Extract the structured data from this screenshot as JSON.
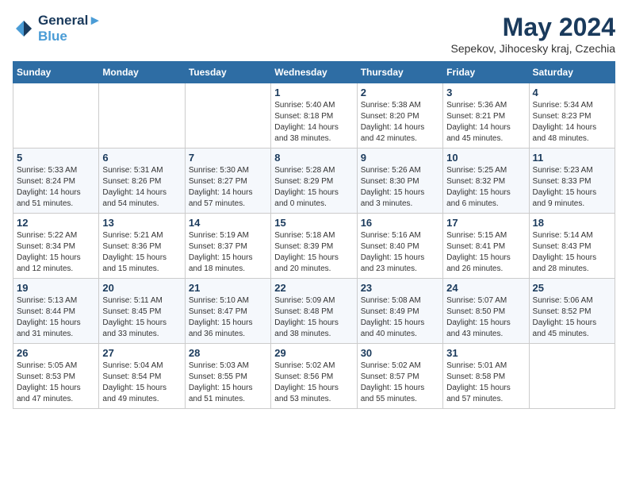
{
  "header": {
    "logo_line1": "General",
    "logo_line2": "Blue",
    "month": "May 2024",
    "location": "Sepekov, Jihocesky kraj, Czechia"
  },
  "weekdays": [
    "Sunday",
    "Monday",
    "Tuesday",
    "Wednesday",
    "Thursday",
    "Friday",
    "Saturday"
  ],
  "weeks": [
    [
      {
        "day": "",
        "info": ""
      },
      {
        "day": "",
        "info": ""
      },
      {
        "day": "",
        "info": ""
      },
      {
        "day": "1",
        "info": "Sunrise: 5:40 AM\nSunset: 8:18 PM\nDaylight: 14 hours\nand 38 minutes."
      },
      {
        "day": "2",
        "info": "Sunrise: 5:38 AM\nSunset: 8:20 PM\nDaylight: 14 hours\nand 42 minutes."
      },
      {
        "day": "3",
        "info": "Sunrise: 5:36 AM\nSunset: 8:21 PM\nDaylight: 14 hours\nand 45 minutes."
      },
      {
        "day": "4",
        "info": "Sunrise: 5:34 AM\nSunset: 8:23 PM\nDaylight: 14 hours\nand 48 minutes."
      }
    ],
    [
      {
        "day": "5",
        "info": "Sunrise: 5:33 AM\nSunset: 8:24 PM\nDaylight: 14 hours\nand 51 minutes."
      },
      {
        "day": "6",
        "info": "Sunrise: 5:31 AM\nSunset: 8:26 PM\nDaylight: 14 hours\nand 54 minutes."
      },
      {
        "day": "7",
        "info": "Sunrise: 5:30 AM\nSunset: 8:27 PM\nDaylight: 14 hours\nand 57 minutes."
      },
      {
        "day": "8",
        "info": "Sunrise: 5:28 AM\nSunset: 8:29 PM\nDaylight: 15 hours\nand 0 minutes."
      },
      {
        "day": "9",
        "info": "Sunrise: 5:26 AM\nSunset: 8:30 PM\nDaylight: 15 hours\nand 3 minutes."
      },
      {
        "day": "10",
        "info": "Sunrise: 5:25 AM\nSunset: 8:32 PM\nDaylight: 15 hours\nand 6 minutes."
      },
      {
        "day": "11",
        "info": "Sunrise: 5:23 AM\nSunset: 8:33 PM\nDaylight: 15 hours\nand 9 minutes."
      }
    ],
    [
      {
        "day": "12",
        "info": "Sunrise: 5:22 AM\nSunset: 8:34 PM\nDaylight: 15 hours\nand 12 minutes."
      },
      {
        "day": "13",
        "info": "Sunrise: 5:21 AM\nSunset: 8:36 PM\nDaylight: 15 hours\nand 15 minutes."
      },
      {
        "day": "14",
        "info": "Sunrise: 5:19 AM\nSunset: 8:37 PM\nDaylight: 15 hours\nand 18 minutes."
      },
      {
        "day": "15",
        "info": "Sunrise: 5:18 AM\nSunset: 8:39 PM\nDaylight: 15 hours\nand 20 minutes."
      },
      {
        "day": "16",
        "info": "Sunrise: 5:16 AM\nSunset: 8:40 PM\nDaylight: 15 hours\nand 23 minutes."
      },
      {
        "day": "17",
        "info": "Sunrise: 5:15 AM\nSunset: 8:41 PM\nDaylight: 15 hours\nand 26 minutes."
      },
      {
        "day": "18",
        "info": "Sunrise: 5:14 AM\nSunset: 8:43 PM\nDaylight: 15 hours\nand 28 minutes."
      }
    ],
    [
      {
        "day": "19",
        "info": "Sunrise: 5:13 AM\nSunset: 8:44 PM\nDaylight: 15 hours\nand 31 minutes."
      },
      {
        "day": "20",
        "info": "Sunrise: 5:11 AM\nSunset: 8:45 PM\nDaylight: 15 hours\nand 33 minutes."
      },
      {
        "day": "21",
        "info": "Sunrise: 5:10 AM\nSunset: 8:47 PM\nDaylight: 15 hours\nand 36 minutes."
      },
      {
        "day": "22",
        "info": "Sunrise: 5:09 AM\nSunset: 8:48 PM\nDaylight: 15 hours\nand 38 minutes."
      },
      {
        "day": "23",
        "info": "Sunrise: 5:08 AM\nSunset: 8:49 PM\nDaylight: 15 hours\nand 40 minutes."
      },
      {
        "day": "24",
        "info": "Sunrise: 5:07 AM\nSunset: 8:50 PM\nDaylight: 15 hours\nand 43 minutes."
      },
      {
        "day": "25",
        "info": "Sunrise: 5:06 AM\nSunset: 8:52 PM\nDaylight: 15 hours\nand 45 minutes."
      }
    ],
    [
      {
        "day": "26",
        "info": "Sunrise: 5:05 AM\nSunset: 8:53 PM\nDaylight: 15 hours\nand 47 minutes."
      },
      {
        "day": "27",
        "info": "Sunrise: 5:04 AM\nSunset: 8:54 PM\nDaylight: 15 hours\nand 49 minutes."
      },
      {
        "day": "28",
        "info": "Sunrise: 5:03 AM\nSunset: 8:55 PM\nDaylight: 15 hours\nand 51 minutes."
      },
      {
        "day": "29",
        "info": "Sunrise: 5:02 AM\nSunset: 8:56 PM\nDaylight: 15 hours\nand 53 minutes."
      },
      {
        "day": "30",
        "info": "Sunrise: 5:02 AM\nSunset: 8:57 PM\nDaylight: 15 hours\nand 55 minutes."
      },
      {
        "day": "31",
        "info": "Sunrise: 5:01 AM\nSunset: 8:58 PM\nDaylight: 15 hours\nand 57 minutes."
      },
      {
        "day": "",
        "info": ""
      }
    ]
  ]
}
